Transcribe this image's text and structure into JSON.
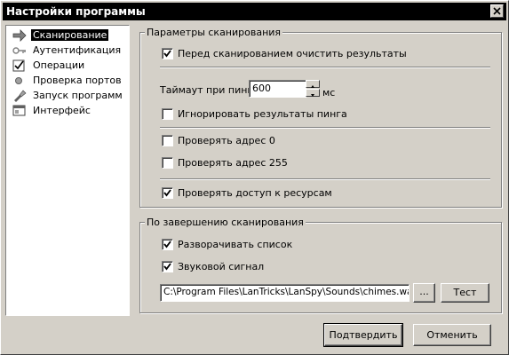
{
  "window": {
    "title": "Настройки программы"
  },
  "sidebar": {
    "items": [
      {
        "label": "Сканирование",
        "icon": "arrow-right-icon",
        "selected": true
      },
      {
        "label": "Аутентификация",
        "icon": "key-icon"
      },
      {
        "label": "Операции",
        "icon": "checklist-icon"
      },
      {
        "label": "Проверка портов",
        "icon": "bullet-icon"
      },
      {
        "label": "Запуск программ",
        "icon": "run-program-icon"
      },
      {
        "label": "Интерфейс",
        "icon": "window-icon"
      }
    ]
  },
  "scan_params": {
    "legend": "Параметры сканирования",
    "clear_results": {
      "label": "Перед сканированием очистить результаты",
      "checked": true
    },
    "ping_timeout": {
      "label": "Таймаут при пинге",
      "value": "600",
      "unit": "мс"
    },
    "ignore_ping": {
      "label": "Игнорировать результаты пинга",
      "checked": false
    },
    "check_addr0": {
      "label": "Проверять адрес 0",
      "checked": false
    },
    "check_addr255": {
      "label": "Проверять адрес 255",
      "checked": false
    },
    "check_shares": {
      "label": "Проверять доступ к ресурсам",
      "checked": true
    }
  },
  "on_finish": {
    "legend": "По завершению сканирования",
    "expand_list": {
      "label": "Разворачивать список",
      "checked": true
    },
    "sound_signal": {
      "label": "Звуковой сигнал",
      "checked": true
    },
    "sound_path": "C:\\Program Files\\LanTricks\\LanSpy\\Sounds\\chimes.wav",
    "browse_label": "...",
    "test_label": "Тест"
  },
  "buttons": {
    "confirm": "Подтвердить",
    "cancel": "Отменить"
  }
}
